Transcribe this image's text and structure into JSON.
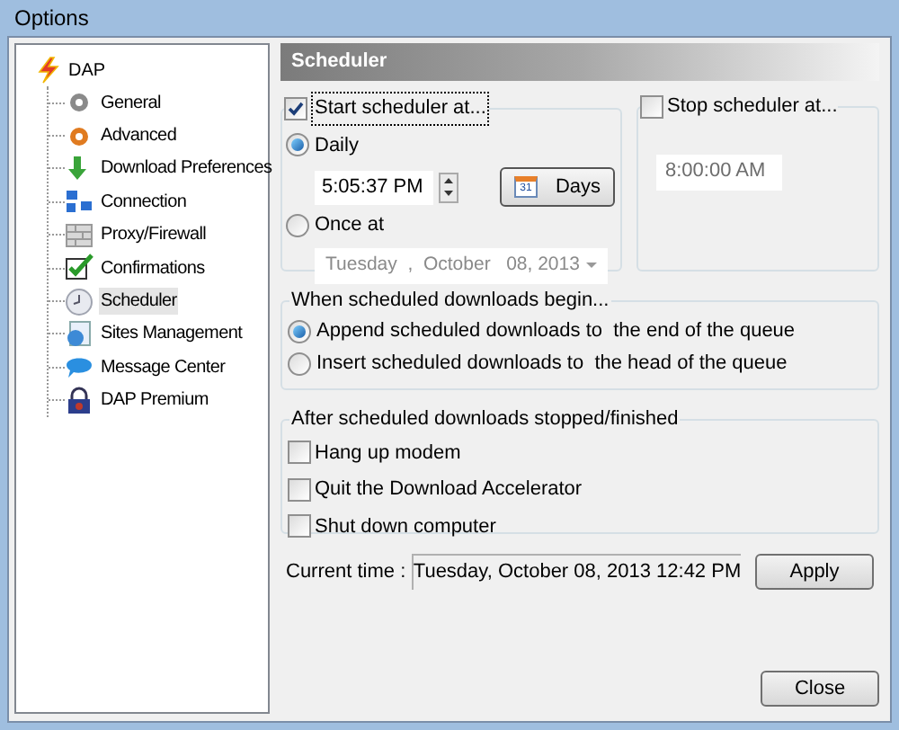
{
  "window": {
    "title": "Options"
  },
  "tree": {
    "label": "DAP",
    "children": [
      {
        "label": "General",
        "selected": false
      },
      {
        "label": "Advanced",
        "selected": false
      },
      {
        "label": "Download Preferences",
        "selected": false
      },
      {
        "label": "Connection",
        "selected": false
      },
      {
        "label": "Proxy/Firewall",
        "selected": false
      },
      {
        "label": "Confirmations",
        "selected": false
      },
      {
        "label": "Scheduler",
        "selected": true
      },
      {
        "label": "Sites Management",
        "selected": false
      },
      {
        "label": "Message Center",
        "selected": false
      },
      {
        "label": "DAP Premium",
        "selected": false
      }
    ]
  },
  "panel_title": "Scheduler",
  "start": {
    "label": "Start scheduler at...",
    "checked": true,
    "options": [
      {
        "label": "Daily",
        "selected": true
      },
      {
        "label": "Once at",
        "selected": false
      }
    ],
    "time": "5:05:37 PM",
    "days_button": {
      "label": "Days",
      "icon_text": "31"
    },
    "date": "Tuesday  ,  October   08, 2013"
  },
  "stop": {
    "label": "Stop scheduler at...",
    "checked": false,
    "time": "8:00:00 AM"
  },
  "begin": {
    "legend": "When scheduled downloads begin...",
    "options": [
      {
        "label": "Append scheduled downloads to  the end of the queue",
        "selected": true
      },
      {
        "label": "Insert scheduled downloads to  the head of the queue",
        "selected": false
      }
    ]
  },
  "after": {
    "legend": "After scheduled downloads stopped/finished",
    "options": [
      {
        "label": "Hang up modem",
        "checked": false
      },
      {
        "label": "Quit the Download Accelerator",
        "checked": false
      },
      {
        "label": "Shut down computer",
        "checked": false
      }
    ]
  },
  "current_time": {
    "label": "Current time :",
    "value": "Tuesday, October 08, 2013 12:42 PM"
  },
  "buttons": {
    "apply": "Apply",
    "close": "Close"
  }
}
